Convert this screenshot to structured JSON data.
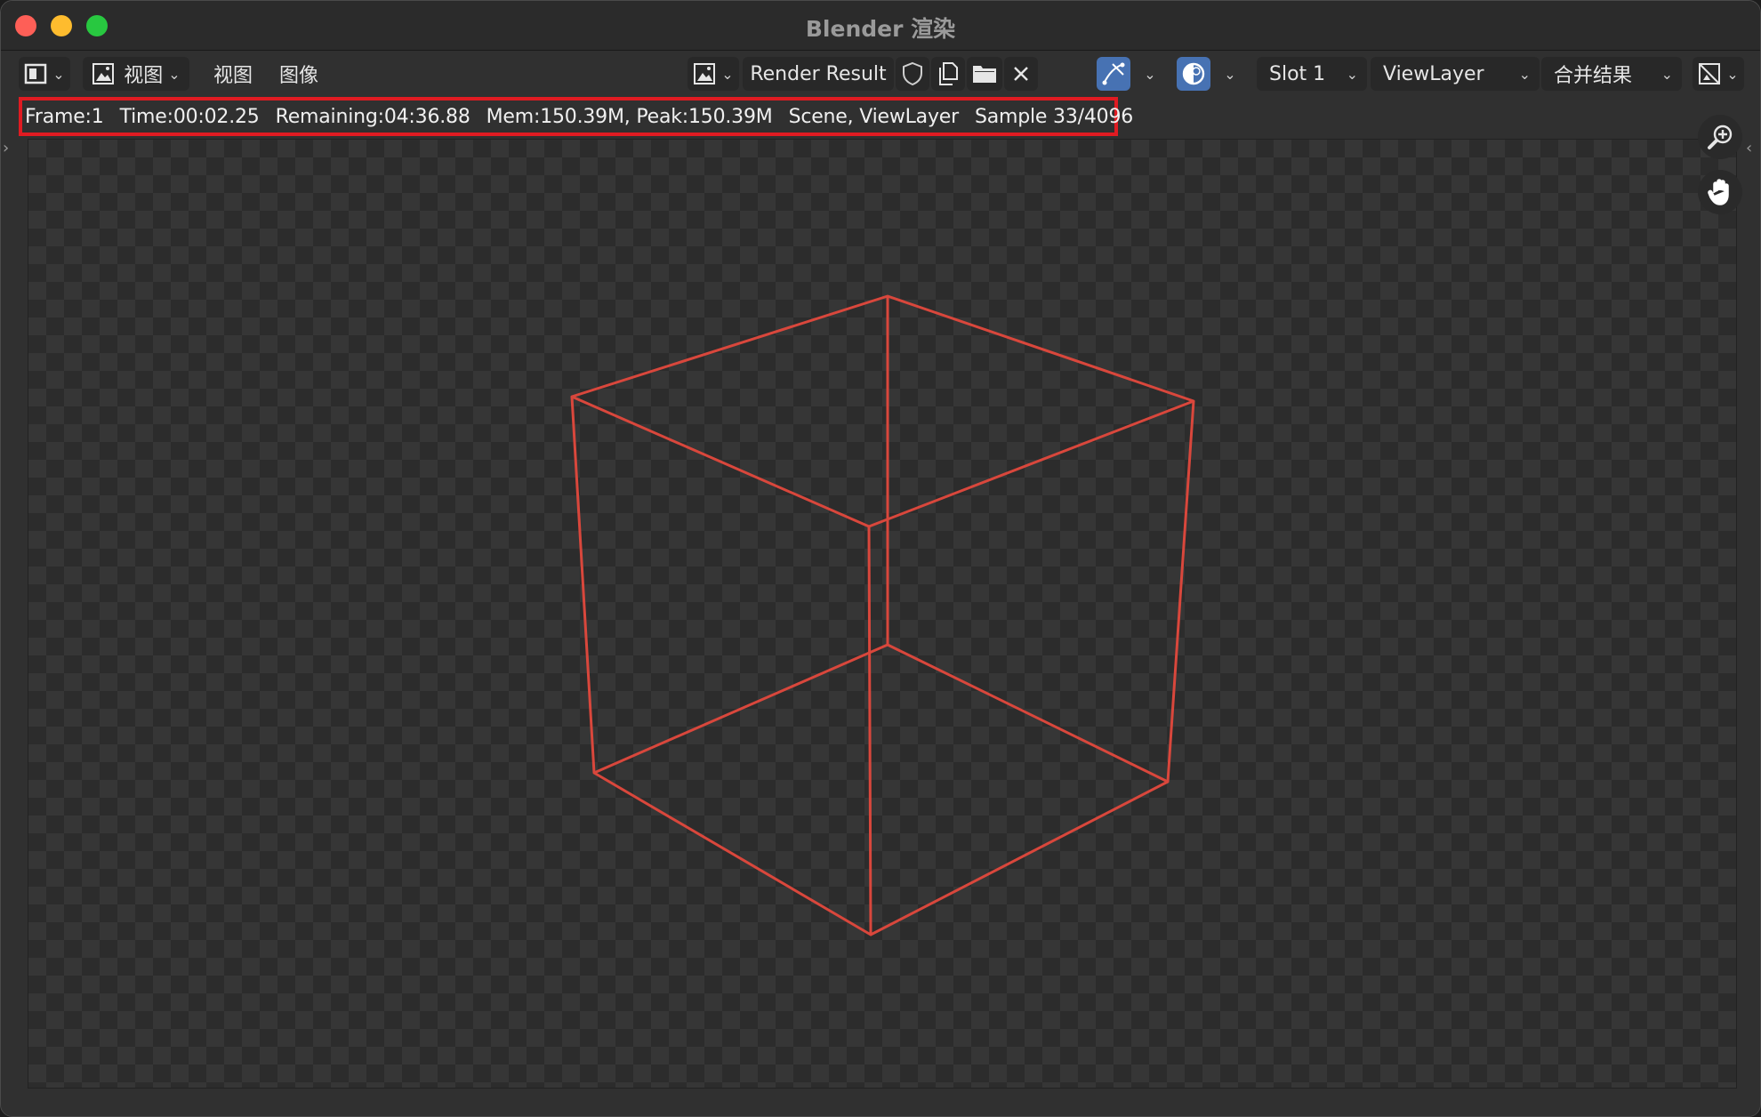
{
  "window": {
    "title": "Blender 渲染"
  },
  "header": {
    "view_menu_label": "视图",
    "menu_view": "视图",
    "menu_image": "图像",
    "image_name": "Render Result",
    "slot": "Slot 1",
    "view_layer": "ViewLayer",
    "pass": "合并结果"
  },
  "stats": {
    "frame": "Frame:1",
    "time": "Time:00:02.25",
    "remaining": "Remaining:04:36.88",
    "mem": "Mem:150.39M, Peak:150.39M",
    "scene": "Scene, ViewLayer",
    "sample": "Sample 33/4096"
  },
  "icons": {
    "editor_type": "image-editor-icon",
    "view_image": "image-icon",
    "fake_user": "shield-icon",
    "duplicate": "duplicate-icon",
    "open": "folder-icon",
    "unlink": "close-icon",
    "sample_tool": "curve-tool-icon",
    "display_channels": "color-alpha-icon",
    "zoom": "zoom-in-icon",
    "pan": "hand-icon"
  },
  "colors": {
    "accent_blue": "#4772b3",
    "highlight_red": "#e01b22",
    "cube_wire": "#d9473c"
  }
}
